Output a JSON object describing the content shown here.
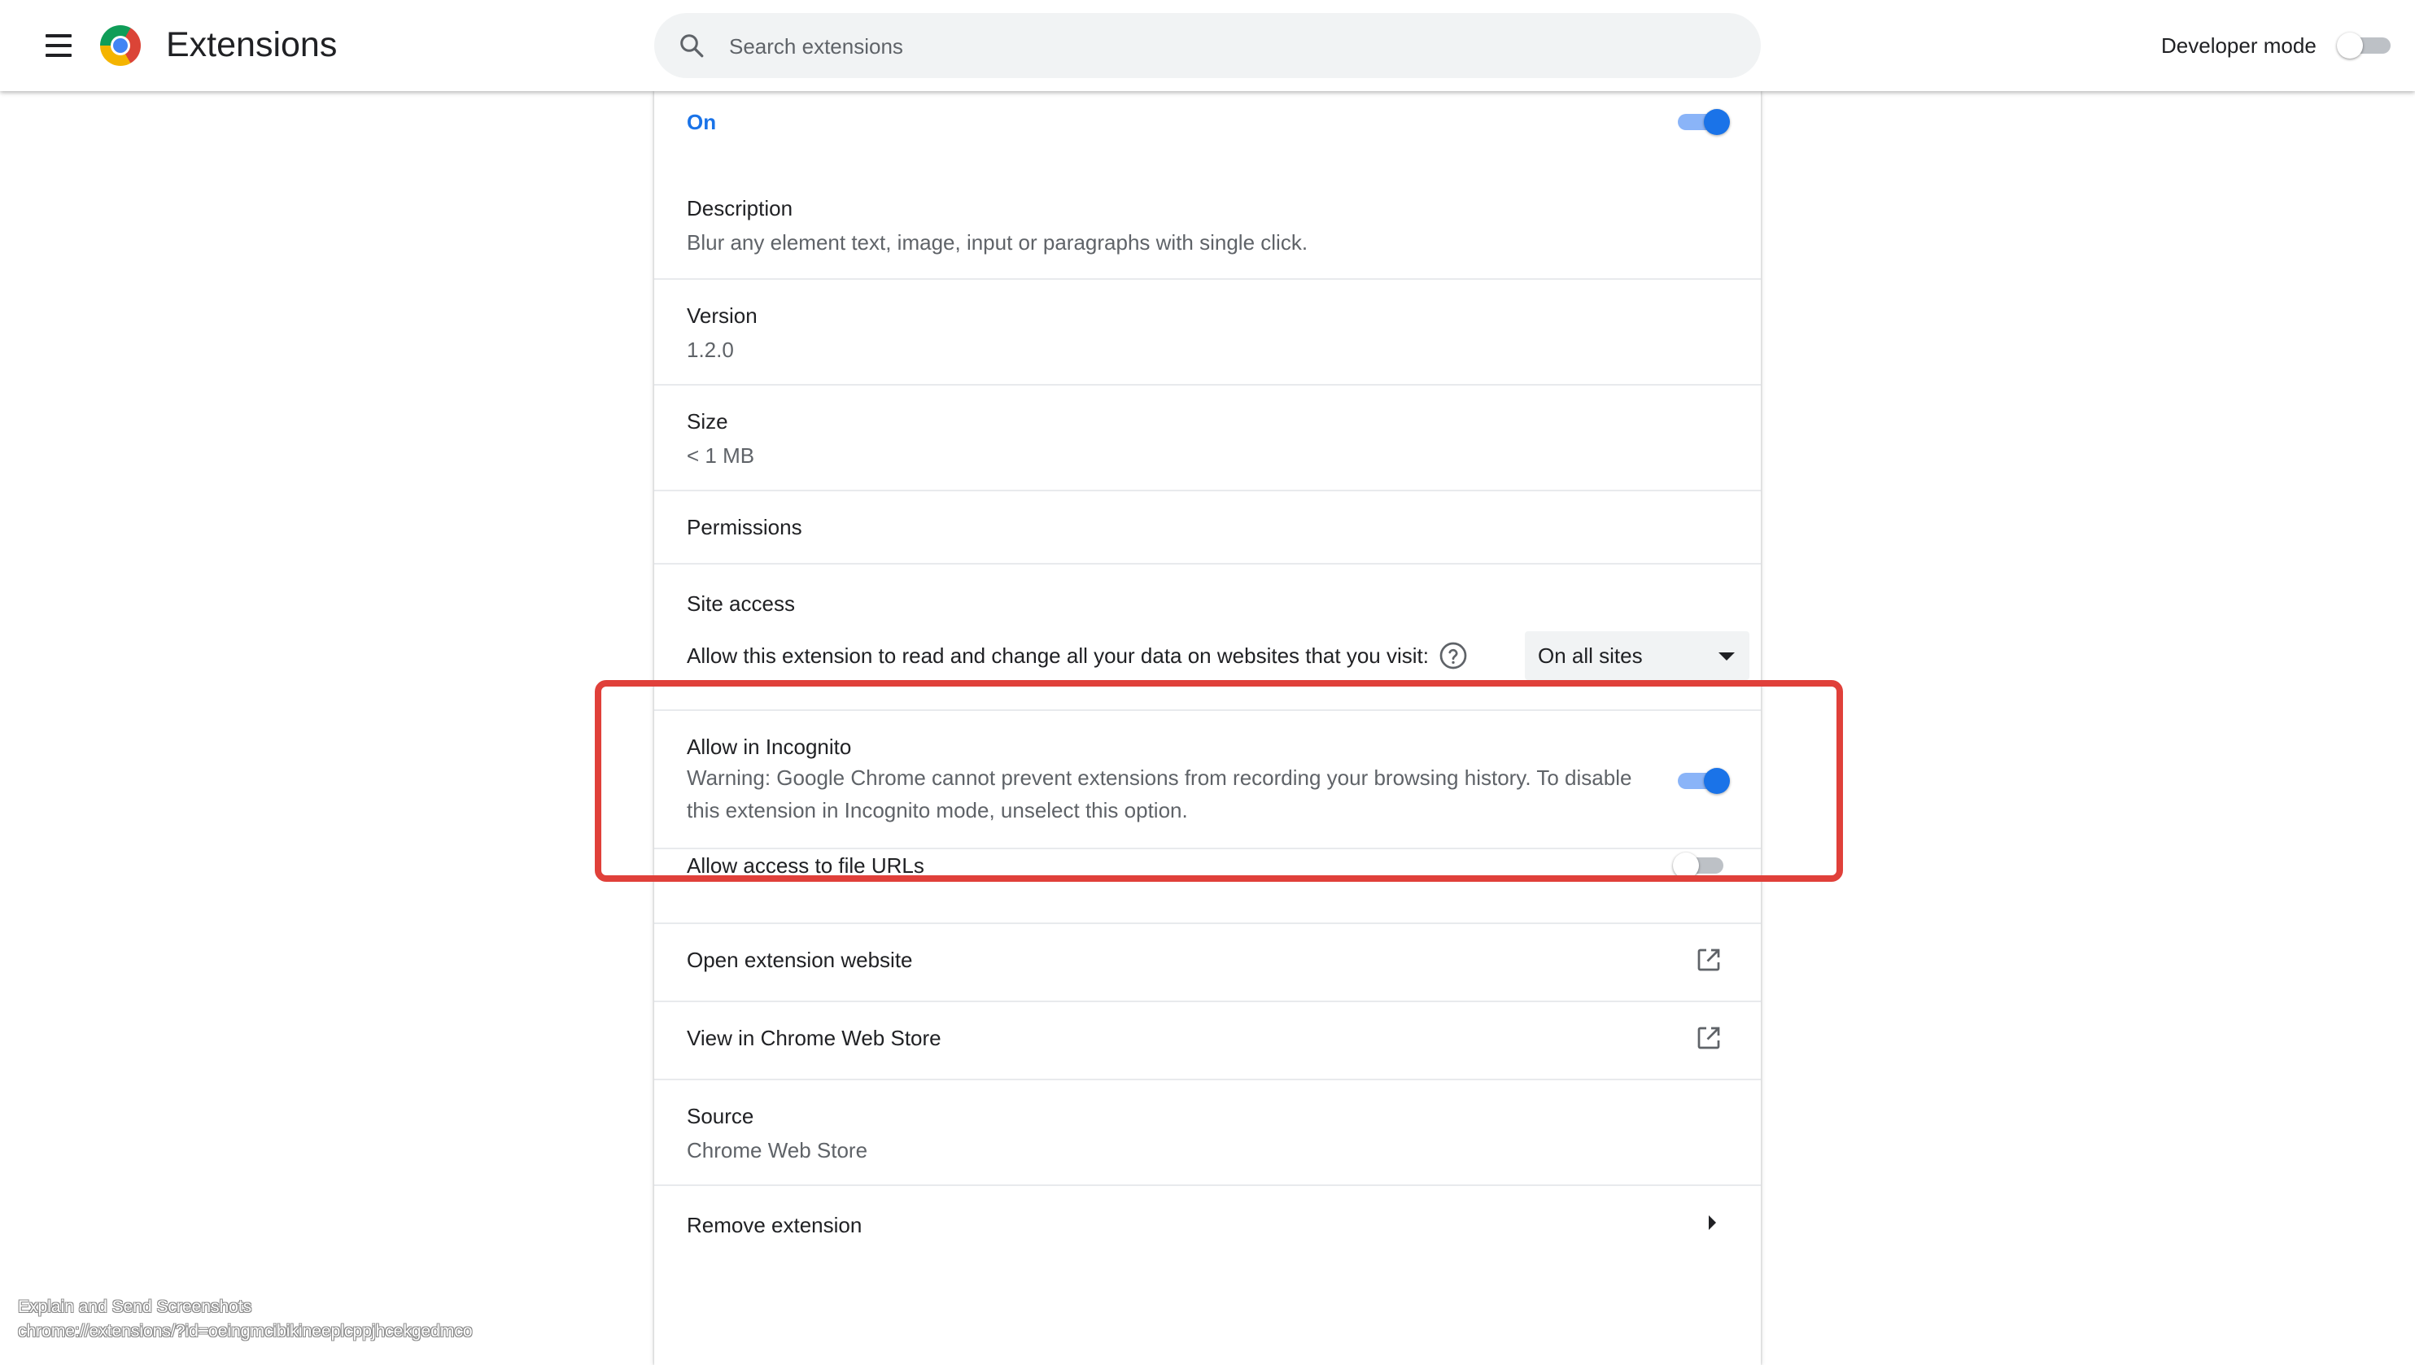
{
  "header": {
    "title": "Extensions",
    "search_placeholder": "Search extensions",
    "developer_mode_label": "Developer mode",
    "developer_mode_enabled": false
  },
  "details": {
    "enabled_label": "On",
    "enabled": true,
    "description_title": "Description",
    "description_text": "Blur any element text, image, input or paragraphs with single click.",
    "version_title": "Version",
    "version_value": "1.2.0",
    "size_title": "Size",
    "size_value": "< 1 MB",
    "permissions_title": "Permissions",
    "site_access_title": "Site access",
    "site_access_text": "Allow this extension to read and change all your data on websites that you visit:",
    "site_access_selected": "On all sites",
    "incognito_title": "Allow in Incognito",
    "incognito_warning": "Warning: Google Chrome cannot prevent extensions from recording your browsing history. To disable this extension in Incognito mode, unselect this option.",
    "incognito_enabled": true,
    "file_urls_title": "Allow access to file URLs",
    "file_urls_enabled": false,
    "open_website_label": "Open extension website",
    "web_store_label": "View in Chrome Web Store",
    "source_title": "Source",
    "source_value": "Chrome Web Store",
    "remove_label": "Remove extension"
  },
  "status_overlay": {
    "line1": "Explain and Send Screenshots",
    "line2": "chrome://extensions/?id=oeingmcibikineeplcppjhcekgedmco"
  },
  "colors": {
    "accent": "#1a73e8",
    "highlight_box": "#e0403a"
  },
  "icons": [
    "menu-icon",
    "chrome-logo",
    "search-icon",
    "help-icon",
    "open-in-new-icon",
    "chevron-right-icon"
  ]
}
